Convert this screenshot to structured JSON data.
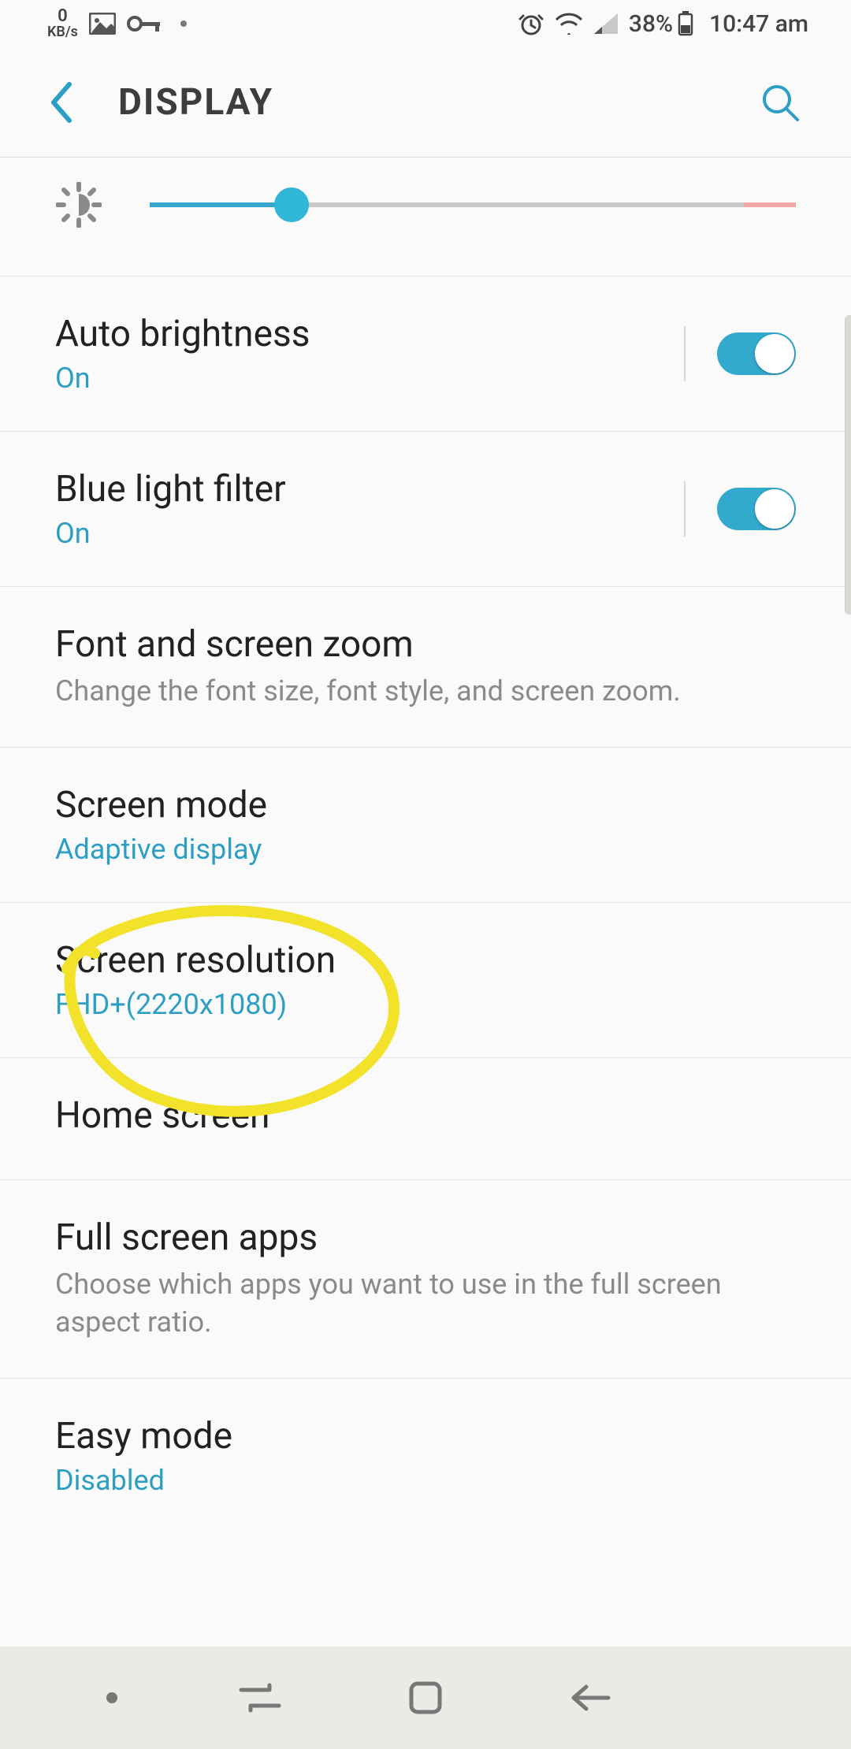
{
  "status": {
    "kbs_value": "0",
    "kbs_label": "KB/s",
    "battery_pct": "38%",
    "time": "10:47 am"
  },
  "header": {
    "title": "DISPLAY"
  },
  "brightness": {
    "slider_value_percent": 22
  },
  "items": {
    "auto_brightness": {
      "title": "Auto brightness",
      "status": "On",
      "toggle": true
    },
    "blue_light": {
      "title": "Blue light filter",
      "status": "On",
      "toggle": true
    },
    "font_zoom": {
      "title": "Font and screen zoom",
      "sub": "Change the font size, font style, and screen zoom."
    },
    "screen_mode": {
      "title": "Screen mode",
      "status": "Adaptive display"
    },
    "screen_res": {
      "title": "Screen resolution",
      "status": "FHD+(2220x1080)"
    },
    "home_screen": {
      "title": "Home screen"
    },
    "full_screen": {
      "title": "Full screen apps",
      "sub": "Choose which apps you want to use in the full screen aspect ratio."
    },
    "easy_mode": {
      "title": "Easy mode",
      "status": "Disabled"
    }
  },
  "colors": {
    "accent": "#2d9ec4",
    "annotation": "#f3e22a"
  }
}
